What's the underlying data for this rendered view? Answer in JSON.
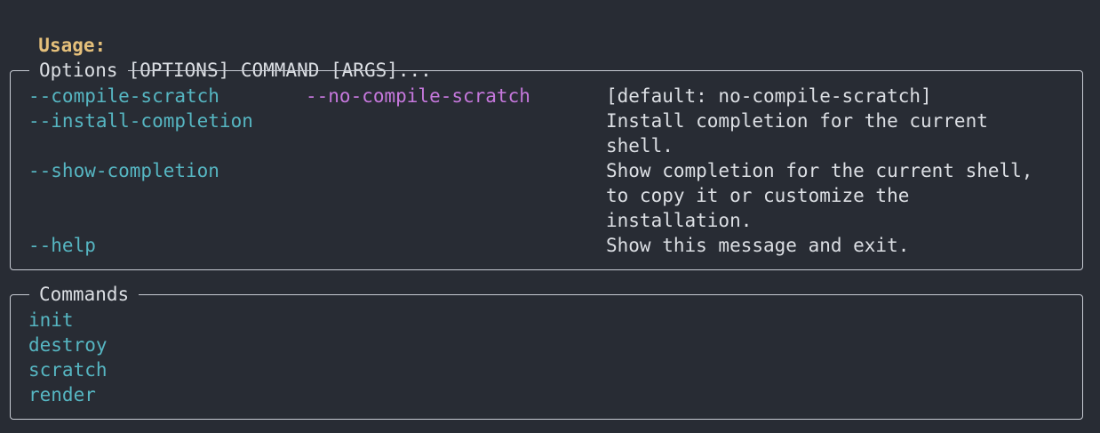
{
  "usage": {
    "label": "Usage:",
    "text": "notaker [OPTIONS] COMMAND [ARGS]..."
  },
  "options_panel": {
    "title": "Options",
    "rows": [
      {
        "flag": "--compile-scratch",
        "negation": "--no-compile-scratch",
        "desc_lines": [
          "[default: no-compile-scratch]"
        ]
      },
      {
        "flag": "--install-completion",
        "negation": "",
        "desc_lines": [
          "Install completion for the current",
          "shell."
        ]
      },
      {
        "flag": "--show-completion",
        "negation": "",
        "desc_lines": [
          "Show completion for the current shell,",
          "to copy it or customize the",
          "installation."
        ]
      },
      {
        "flag": "--help",
        "negation": "",
        "desc_lines": [
          "Show this message and exit."
        ]
      }
    ]
  },
  "commands_panel": {
    "title": "Commands",
    "items": [
      "init",
      "destroy",
      "scratch",
      "render"
    ]
  },
  "colors": {
    "background": "#282c34",
    "usage_label": "#e5c07b",
    "option_flag": "#56b6c2",
    "negation_flag": "#c678dd",
    "text": "#dcdfe4",
    "border": "#c8ccd4"
  }
}
